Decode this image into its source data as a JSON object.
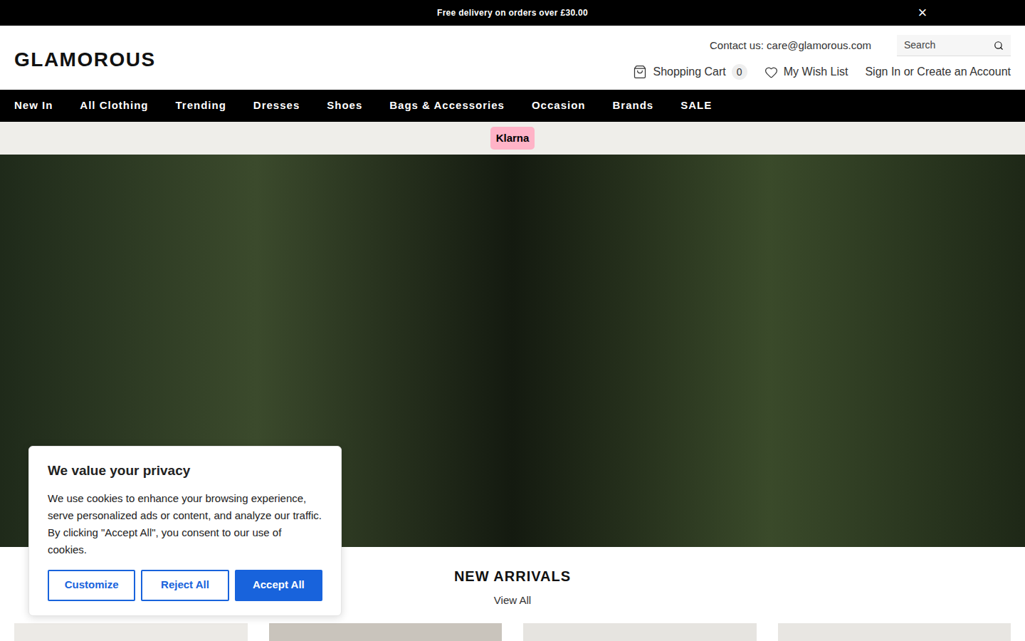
{
  "announcement": {
    "text": "Free delivery on orders over £30.00",
    "close": "×"
  },
  "header": {
    "logo": "GLAMOROUS",
    "contact": "Contact us: care@glamorous.com",
    "search": {
      "placeholder": "Search"
    },
    "cart": {
      "label": "Shopping Cart",
      "count": "0"
    },
    "wishlist": "My Wish List",
    "account": "Sign In or Create an Account"
  },
  "nav": {
    "items": [
      {
        "label": "New In"
      },
      {
        "label": "All Clothing"
      },
      {
        "label": "Trending"
      },
      {
        "label": "Dresses"
      },
      {
        "label": "Shoes"
      },
      {
        "label": "Bags & Accessories"
      },
      {
        "label": "Occasion"
      },
      {
        "label": "Brands"
      },
      {
        "label": "SALE"
      }
    ]
  },
  "promo": {
    "badge": "Klarna"
  },
  "section": {
    "title": "NEW ARRIVALS",
    "link": "View All"
  },
  "products": [
    {
      "color": "#eceae6"
    },
    {
      "color": "#c9c4bc"
    },
    {
      "color": "#e6e4e0"
    },
    {
      "color": "#e8e6e2"
    }
  ],
  "cookie": {
    "title": "We value your privacy",
    "body": "We use cookies to enhance your browsing experience, serve personalized ads or content, and analyze our traffic. By clicking \"Accept All\", you consent to our use of cookies.",
    "buttons": [
      {
        "label": "Customize",
        "kind": "outline"
      },
      {
        "label": "Reject All",
        "kind": "outline"
      },
      {
        "label": "Accept All",
        "kind": "primary"
      }
    ]
  }
}
